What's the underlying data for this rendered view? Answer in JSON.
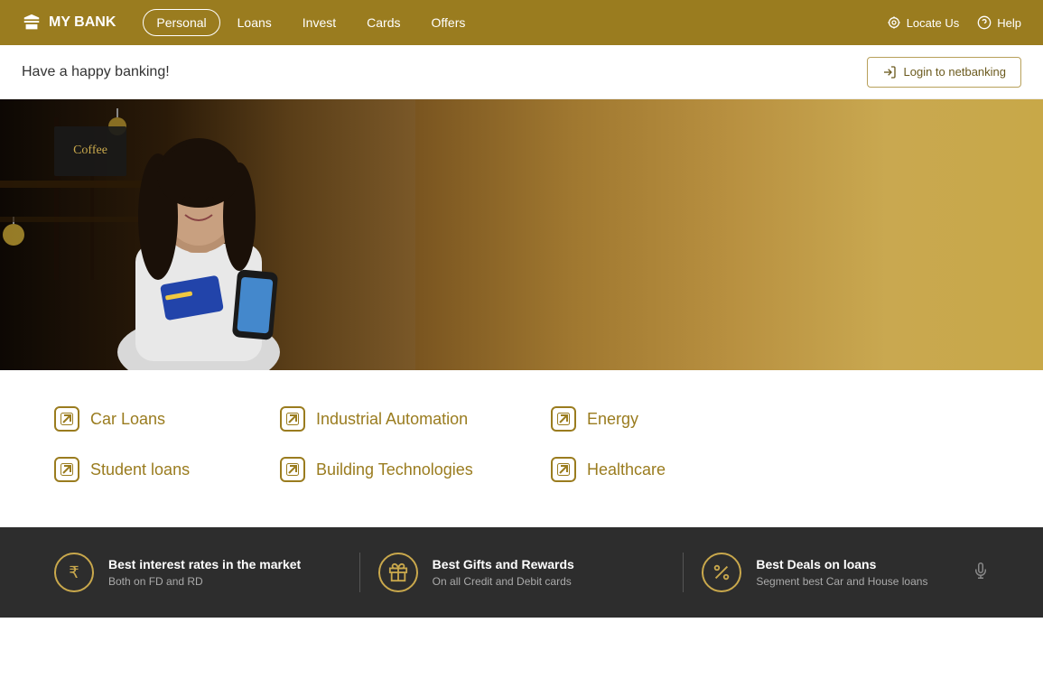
{
  "nav": {
    "logo_text": "MY BANK",
    "links": [
      {
        "label": "Personal",
        "active": true
      },
      {
        "label": "Loans",
        "active": false
      },
      {
        "label": "Invest",
        "active": false
      },
      {
        "label": "Cards",
        "active": false
      },
      {
        "label": "Offers",
        "active": false
      }
    ],
    "right_items": [
      {
        "label": "Locate Us",
        "icon": "locate-icon"
      },
      {
        "label": "Help",
        "icon": "help-icon"
      }
    ]
  },
  "subheader": {
    "tagline": "Have a happy banking!",
    "login_button": "Login to netbanking"
  },
  "hero": {
    "alt": "Woman holding credit card and phone in cafe"
  },
  "links": [
    {
      "label": "Car Loans",
      "col": 1,
      "row": 1
    },
    {
      "label": "Industrial Automation",
      "col": 2,
      "row": 1
    },
    {
      "label": "Energy",
      "col": 3,
      "row": 1
    },
    {
      "label": "Student loans",
      "col": 1,
      "row": 2
    },
    {
      "label": "Building Technologies",
      "col": 2,
      "row": 2
    },
    {
      "label": "Healthcare",
      "col": 3,
      "row": 2
    }
  ],
  "footer": {
    "items": [
      {
        "icon": "rupee-icon",
        "icon_symbol": "₹",
        "title": "Best interest rates in the market",
        "subtitle": "Both on FD and RD"
      },
      {
        "icon": "gift-icon",
        "icon_symbol": "🎁",
        "title": "Best Gifts and Rewards",
        "subtitle": "On all Credit and Debit cards"
      },
      {
        "icon": "percent-icon",
        "icon_symbol": "%",
        "title": "Best Deals on loans",
        "subtitle": "Segment best Car and House loans"
      }
    ],
    "mic_icon": "mic-icon"
  }
}
